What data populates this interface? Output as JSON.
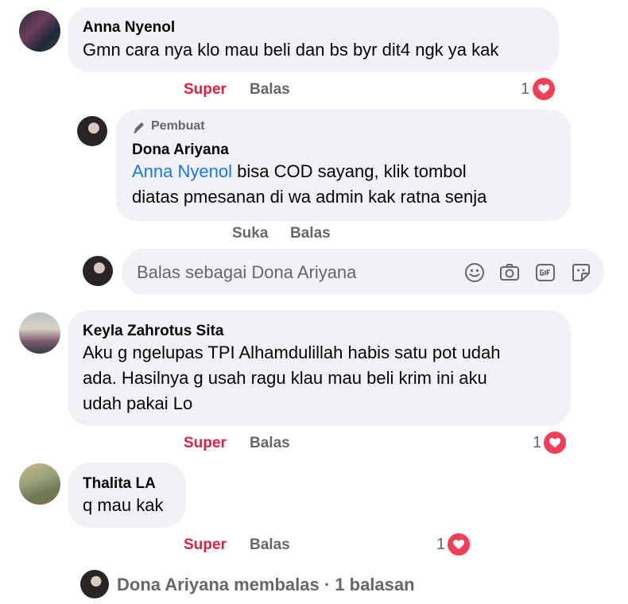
{
  "comments": [
    {
      "author": "Anna Nyenol",
      "text": "Gmn cara nya klo mau beli dan bs byr dit4 ngk ya kak",
      "actions": {
        "react": "Super",
        "reply": "Balas"
      },
      "reaction_count": "1"
    },
    {
      "author": "Keyla Zahrotus Sita",
      "text_lines": [
        "Aku g ngelupas TPI Alhamdulillah habis satu pot udah",
        "ada. Hasilnya g usah ragu klau mau beli krim ini aku",
        "udah pakai Lo"
      ],
      "actions": {
        "react": "Super",
        "reply": "Balas"
      },
      "reaction_count": "1"
    },
    {
      "author": "Thalita LA",
      "text": "q mau kak",
      "actions": {
        "react": "Super",
        "reply": "Balas"
      },
      "reaction_count": "1"
    }
  ],
  "creator_reply": {
    "badge": "Pembuat",
    "author": "Dona Ariyana",
    "mention": "Anna Nyenol",
    "text_line1": " bisa COD sayang, klik tombol",
    "text_line2": "diatas pmesanan di wa admin kak ratna senja",
    "actions": {
      "like": "Suka",
      "reply": "Balas"
    }
  },
  "reply_box": {
    "placeholder": "Balas sebagai Dona Ariyana",
    "icons": [
      "emoji-icon",
      "camera-icon",
      "gif-icon",
      "sticker-icon"
    ]
  },
  "replies_summary": "Dona Ariyana membalas · 1 balasan",
  "colors": {
    "super": "#e41e3f",
    "mention": "#1877f2",
    "heart": "#f33e58",
    "bubble": "#f0f2f5",
    "muted": "#65676b"
  }
}
